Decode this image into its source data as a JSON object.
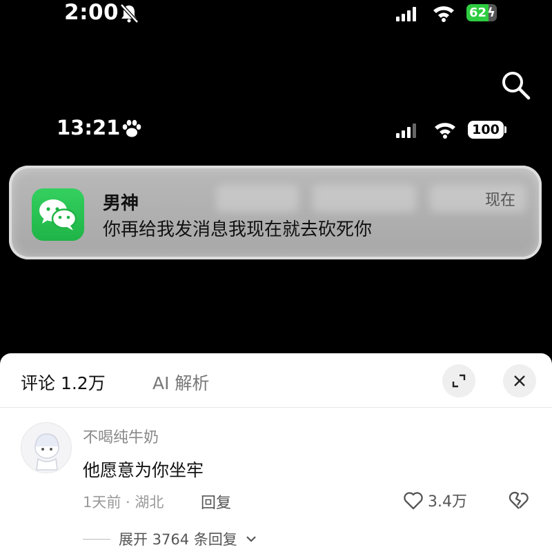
{
  "outer_status": {
    "time": "2:00",
    "battery": "62"
  },
  "inner_status": {
    "time": "13:21",
    "battery": "100"
  },
  "notification": {
    "sender": "男神",
    "message": "你再给我发消息我现在就去砍死你",
    "time": "现在",
    "app_icon": "wechat-icon"
  },
  "comments_panel": {
    "tabs": [
      {
        "label": "评论 1.2万"
      },
      {
        "label": "AI 解析"
      }
    ],
    "comment": {
      "username": "不喝纯牛奶",
      "text": "他愿意为你坐牢",
      "meta": "1天前 · 湖北",
      "reply_label": "回复",
      "likes": "3.4万"
    },
    "expand_label": "展开 3764 条回复"
  },
  "colors": {
    "wechat_green": "#1fb447",
    "battery_green": "#2ecc40",
    "sheet_bg": "#ffffff"
  }
}
